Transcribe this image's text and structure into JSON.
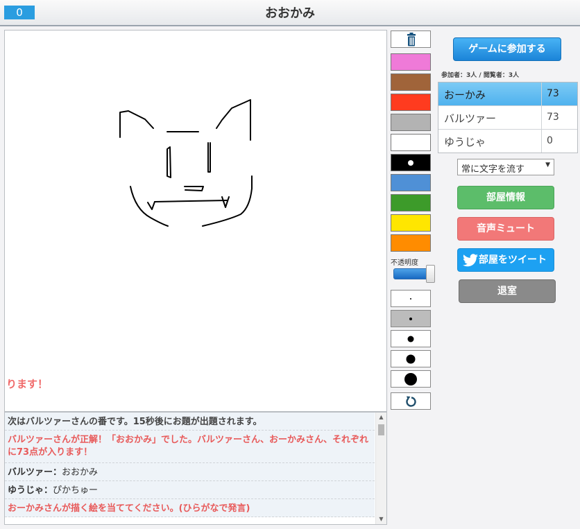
{
  "header": {
    "counter": "0",
    "title": "おおかみ"
  },
  "canvas": {
    "overlay_message": "ります！"
  },
  "chat": {
    "messages": [
      {
        "kind": "system",
        "text": "次はバルツァーさんの番です。15秒後にお題が出題されます。"
      },
      {
        "kind": "alert",
        "text": "バルツァーさんが正解！「おおかみ」でした。バルツァーさん、おーかみさん、それぞれに73点が入ります！"
      },
      {
        "kind": "chat",
        "name": "バルツァー：",
        "text": "おおかみ"
      },
      {
        "kind": "chat",
        "name": "ゆうじゃ：",
        "text": "ぴかちゅー"
      },
      {
        "kind": "alert",
        "text": "おーかみさんが描く絵を当ててください。(ひらがなで発言)"
      }
    ]
  },
  "tools": {
    "trash_icon": "trash-icon",
    "palette": [
      "#ef7ad8",
      "#a0643a",
      "#ff3b1f",
      "#b3b3b3",
      "#ffffff",
      "#000000",
      "#4f90d6",
      "#3d9b2a",
      "#ffe600",
      "#ff8c00"
    ],
    "selected_color": "#000000",
    "opacity_label": "不透明度",
    "opacity": 1.0,
    "brush_sizes": [
      "xs",
      "s",
      "m",
      "l",
      "xl"
    ],
    "selected_size": "s",
    "undo_icon": "undo-icon"
  },
  "panel": {
    "join_label": "ゲームに参加する",
    "counts": "参加者：3人 / 閲覧者：3人",
    "players": [
      {
        "name": "おーかみ",
        "score": "73",
        "active": true
      },
      {
        "name": "バルツァー",
        "score": "73",
        "active": false
      },
      {
        "name": "ゆうじゃ",
        "score": "0",
        "active": false
      }
    ],
    "scroll_mode": "常に文字を流す",
    "room_info_label": "部屋情報",
    "mute_label": "音声ミュート",
    "tweet_label": "部屋をツイート",
    "leave_label": "退室",
    "colors": {
      "join": "#1b84d8",
      "room_info": "#5cbd6a",
      "mute": "#f27878",
      "tweet": "#1da1f2",
      "leave": "#8a8a8a"
    }
  }
}
